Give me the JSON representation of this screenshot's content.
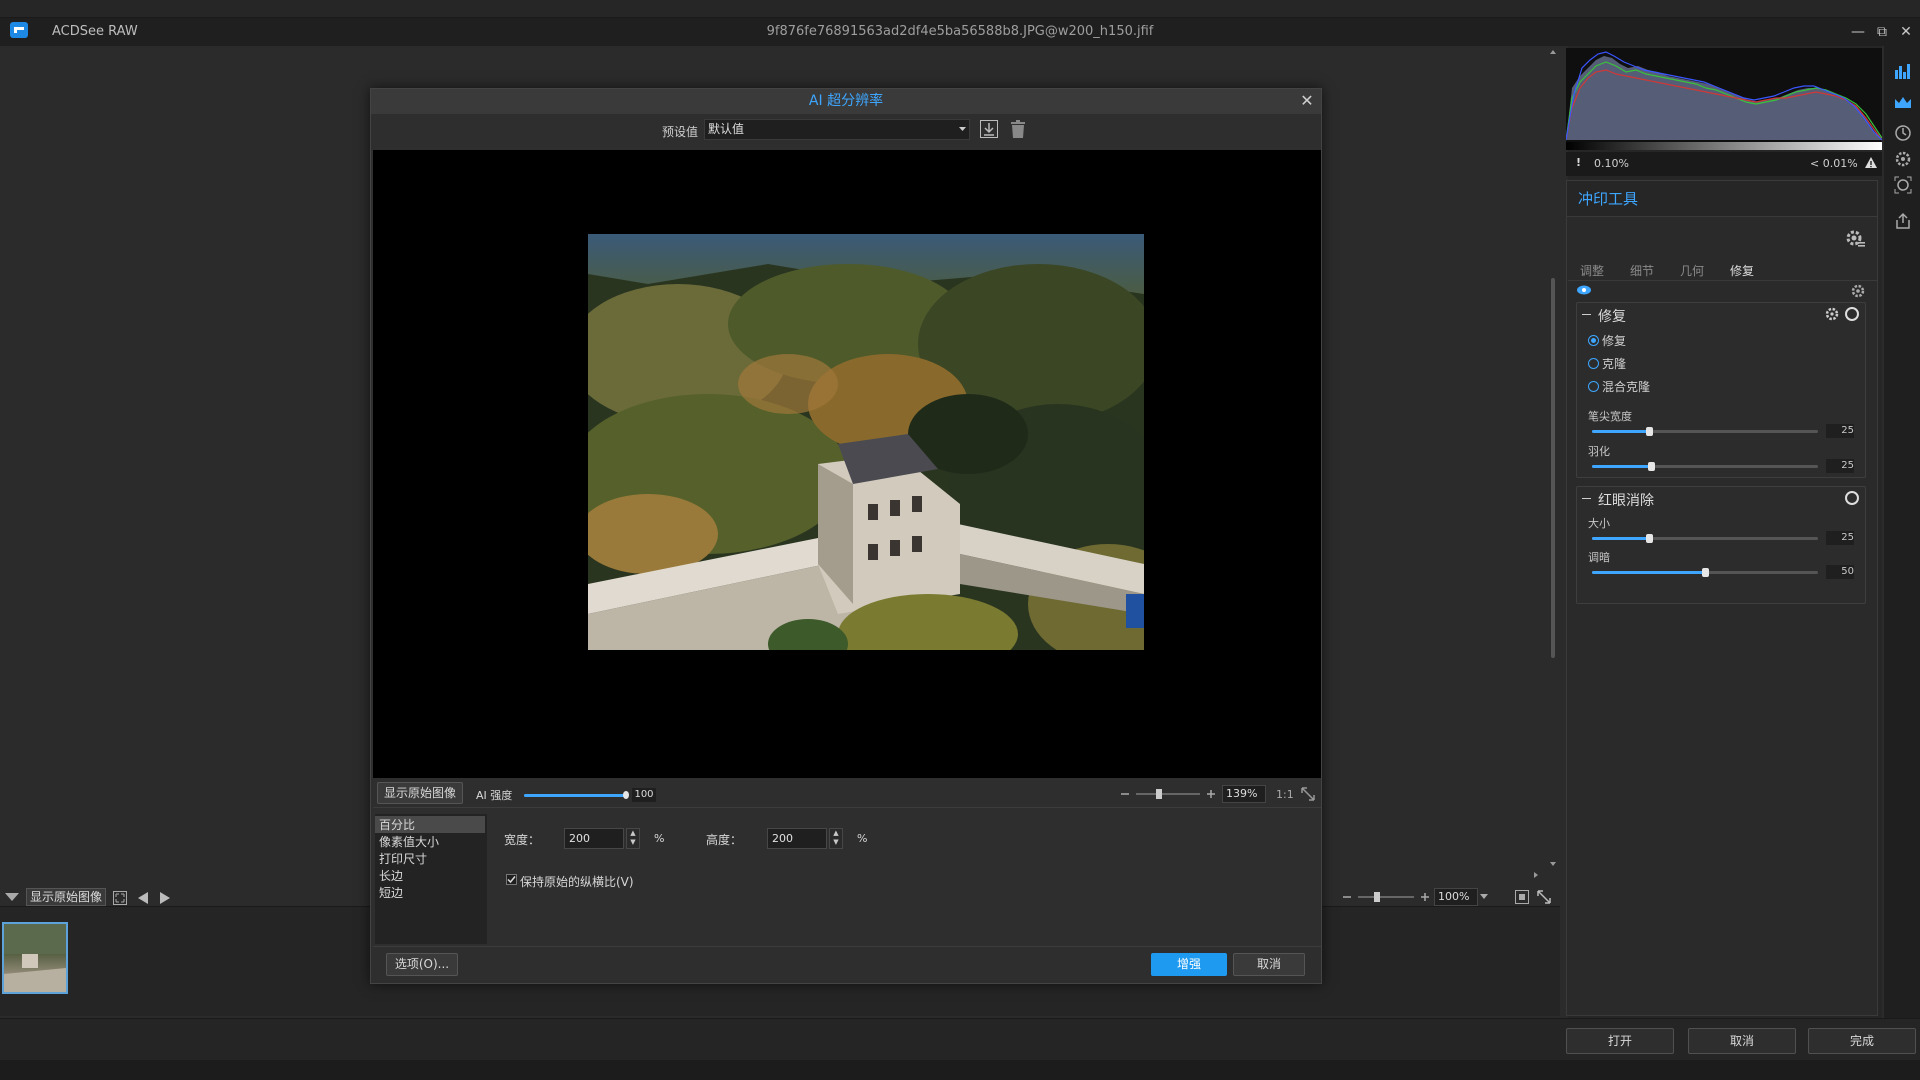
{
  "window": {
    "app_title": "ACDSee RAW",
    "file_title": "9f876fe76891563ad2df4e5ba56588b8.JPG@w200_h150.jfif",
    "minimize": "—",
    "restore": "⧉",
    "close": "✕"
  },
  "filmstrip": {
    "show_original": "显示原始图像",
    "zoom_value": "100%"
  },
  "dialog": {
    "title": "AI 超分辨率",
    "preset_label": "预设值",
    "preset_value": "默认值",
    "show_original": "显示原始图像",
    "ai_strength_label": "AI 强度",
    "ai_strength_value": "100",
    "ai_strength_fraction": 1.0,
    "zoom_value": "139%",
    "one_to_one": "1:1",
    "modes": [
      "百分比",
      "像素值大小",
      "打印尺寸",
      "长边",
      "短边"
    ],
    "selected_mode": "百分比",
    "width_label": "宽度：",
    "width_value": "200",
    "height_label": "高度：",
    "height_value": "200",
    "percent_unit": "%",
    "keep_ratio_label": "保持原始的纵横比(V)",
    "keep_ratio_checked": true,
    "options_button": "选项(O)...",
    "enhance_button": "增强",
    "cancel_button": "取消"
  },
  "histogram": {
    "left_clip": "0.10%",
    "right_clip": "< 0.01%"
  },
  "develop": {
    "panel_title": "冲印工具",
    "tabs": [
      "调整",
      "细节",
      "几何",
      "修复"
    ],
    "active_tab": "修复",
    "repair_group": {
      "title": "修复",
      "options": [
        "修复",
        "克隆",
        "混合克隆"
      ],
      "selected": "修复",
      "sliders": [
        {
          "label": "笔尖宽度",
          "value": "25",
          "fraction": 0.25
        },
        {
          "label": "羽化",
          "value": "25",
          "fraction": 0.26
        }
      ]
    },
    "redeye_group": {
      "title": "红眼消除",
      "sliders": [
        {
          "label": "大小",
          "value": "25",
          "fraction": 0.25
        },
        {
          "label": "调暗",
          "value": "50",
          "fraction": 0.5
        }
      ]
    }
  },
  "bottom": {
    "open": "打开",
    "cancel": "取消",
    "done": "完成"
  },
  "colors": {
    "accent": "#1e9bf0",
    "title_blue": "#3ea6ff"
  }
}
